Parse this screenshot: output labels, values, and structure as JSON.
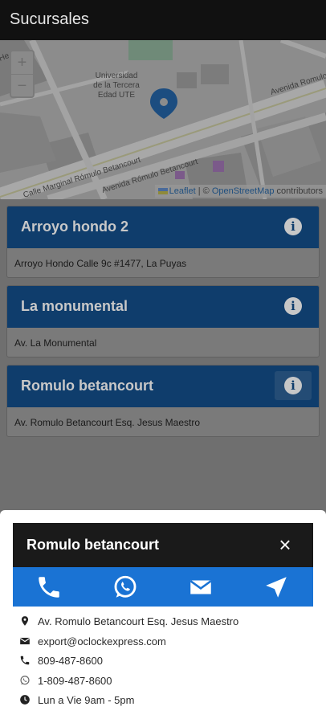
{
  "appbar": {
    "title": "Sucursales"
  },
  "map": {
    "zoom_in": "+",
    "zoom_out": "−",
    "labels": {
      "university": [
        "Universidad",
        "de la Tercera",
        "Edad UTE"
      ],
      "avenida_romulo": "Avenida Romulo",
      "calle_marginal": "Calle Marginal Rómulo Betancourt",
      "avenida_romulo_b": "Avenida Rómulo Betancourt",
      "top_left": "He"
    },
    "attribution": {
      "leaflet": "Leaflet",
      "separator": " | © ",
      "osm": "OpenStreetMap",
      "contributors": " contributors"
    }
  },
  "branches": [
    {
      "name": "Arroyo hondo 2",
      "address": "Arroyo Hondo Calle 9c #1477, La Puyas"
    },
    {
      "name": "La monumental",
      "address": "Av. La Monumental"
    },
    {
      "name": "Romulo betancourt",
      "address": "Av. Romulo Betancourt Esq. Jesus Maestro"
    }
  ],
  "detail": {
    "title": "Romulo betancourt",
    "close_icon": "×",
    "address": "Av. Romulo Betancourt Esq. Jesus Maestro",
    "email": "export@oclockexpress.com",
    "phone": "809-487-8600",
    "whatsapp": "1-809-487-8600",
    "hours": "Lun a Vie 9am - 5pm"
  },
  "colors": {
    "appbar": "#111111",
    "card_header": "#0f3d6c",
    "action_bar": "#1a73d4",
    "marker": "#1c4d80"
  }
}
